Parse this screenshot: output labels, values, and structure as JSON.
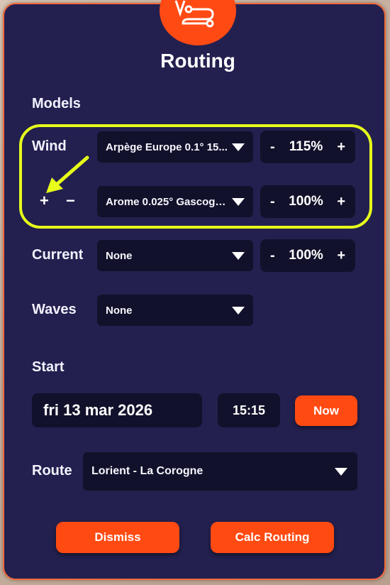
{
  "dialog": {
    "title": "Routing",
    "logo_icon": "route-icon"
  },
  "models": {
    "heading": "Models",
    "wind": {
      "label": "Wind",
      "add_label": "+",
      "remove_label": "−",
      "rows": [
        {
          "model": "Arpège Europe 0.1°  15...",
          "minus": "-",
          "percent": "115%",
          "plus": "+"
        },
        {
          "model": "Arome 0.025° Gascogn...",
          "minus": "-",
          "percent": "100%",
          "plus": "+"
        }
      ]
    },
    "current": {
      "label": "Current",
      "model": "None",
      "minus": "-",
      "percent": "100%",
      "plus": "+"
    },
    "waves": {
      "label": "Waves",
      "model": "None"
    }
  },
  "start": {
    "heading": "Start",
    "date": "fri 13 mar 2026",
    "time": "15:15",
    "now_label": "Now"
  },
  "route": {
    "label": "Route",
    "value": "Lorient - La Corogne"
  },
  "actions": {
    "dismiss": "Dismiss",
    "calc": "Calc Routing"
  },
  "annotation": {
    "highlight_color": "#e7ff1a",
    "arrow_color": "#e7ff1a"
  },
  "colors": {
    "accent": "#ff4a14",
    "panel": "#23204f",
    "field": "#12112b"
  }
}
